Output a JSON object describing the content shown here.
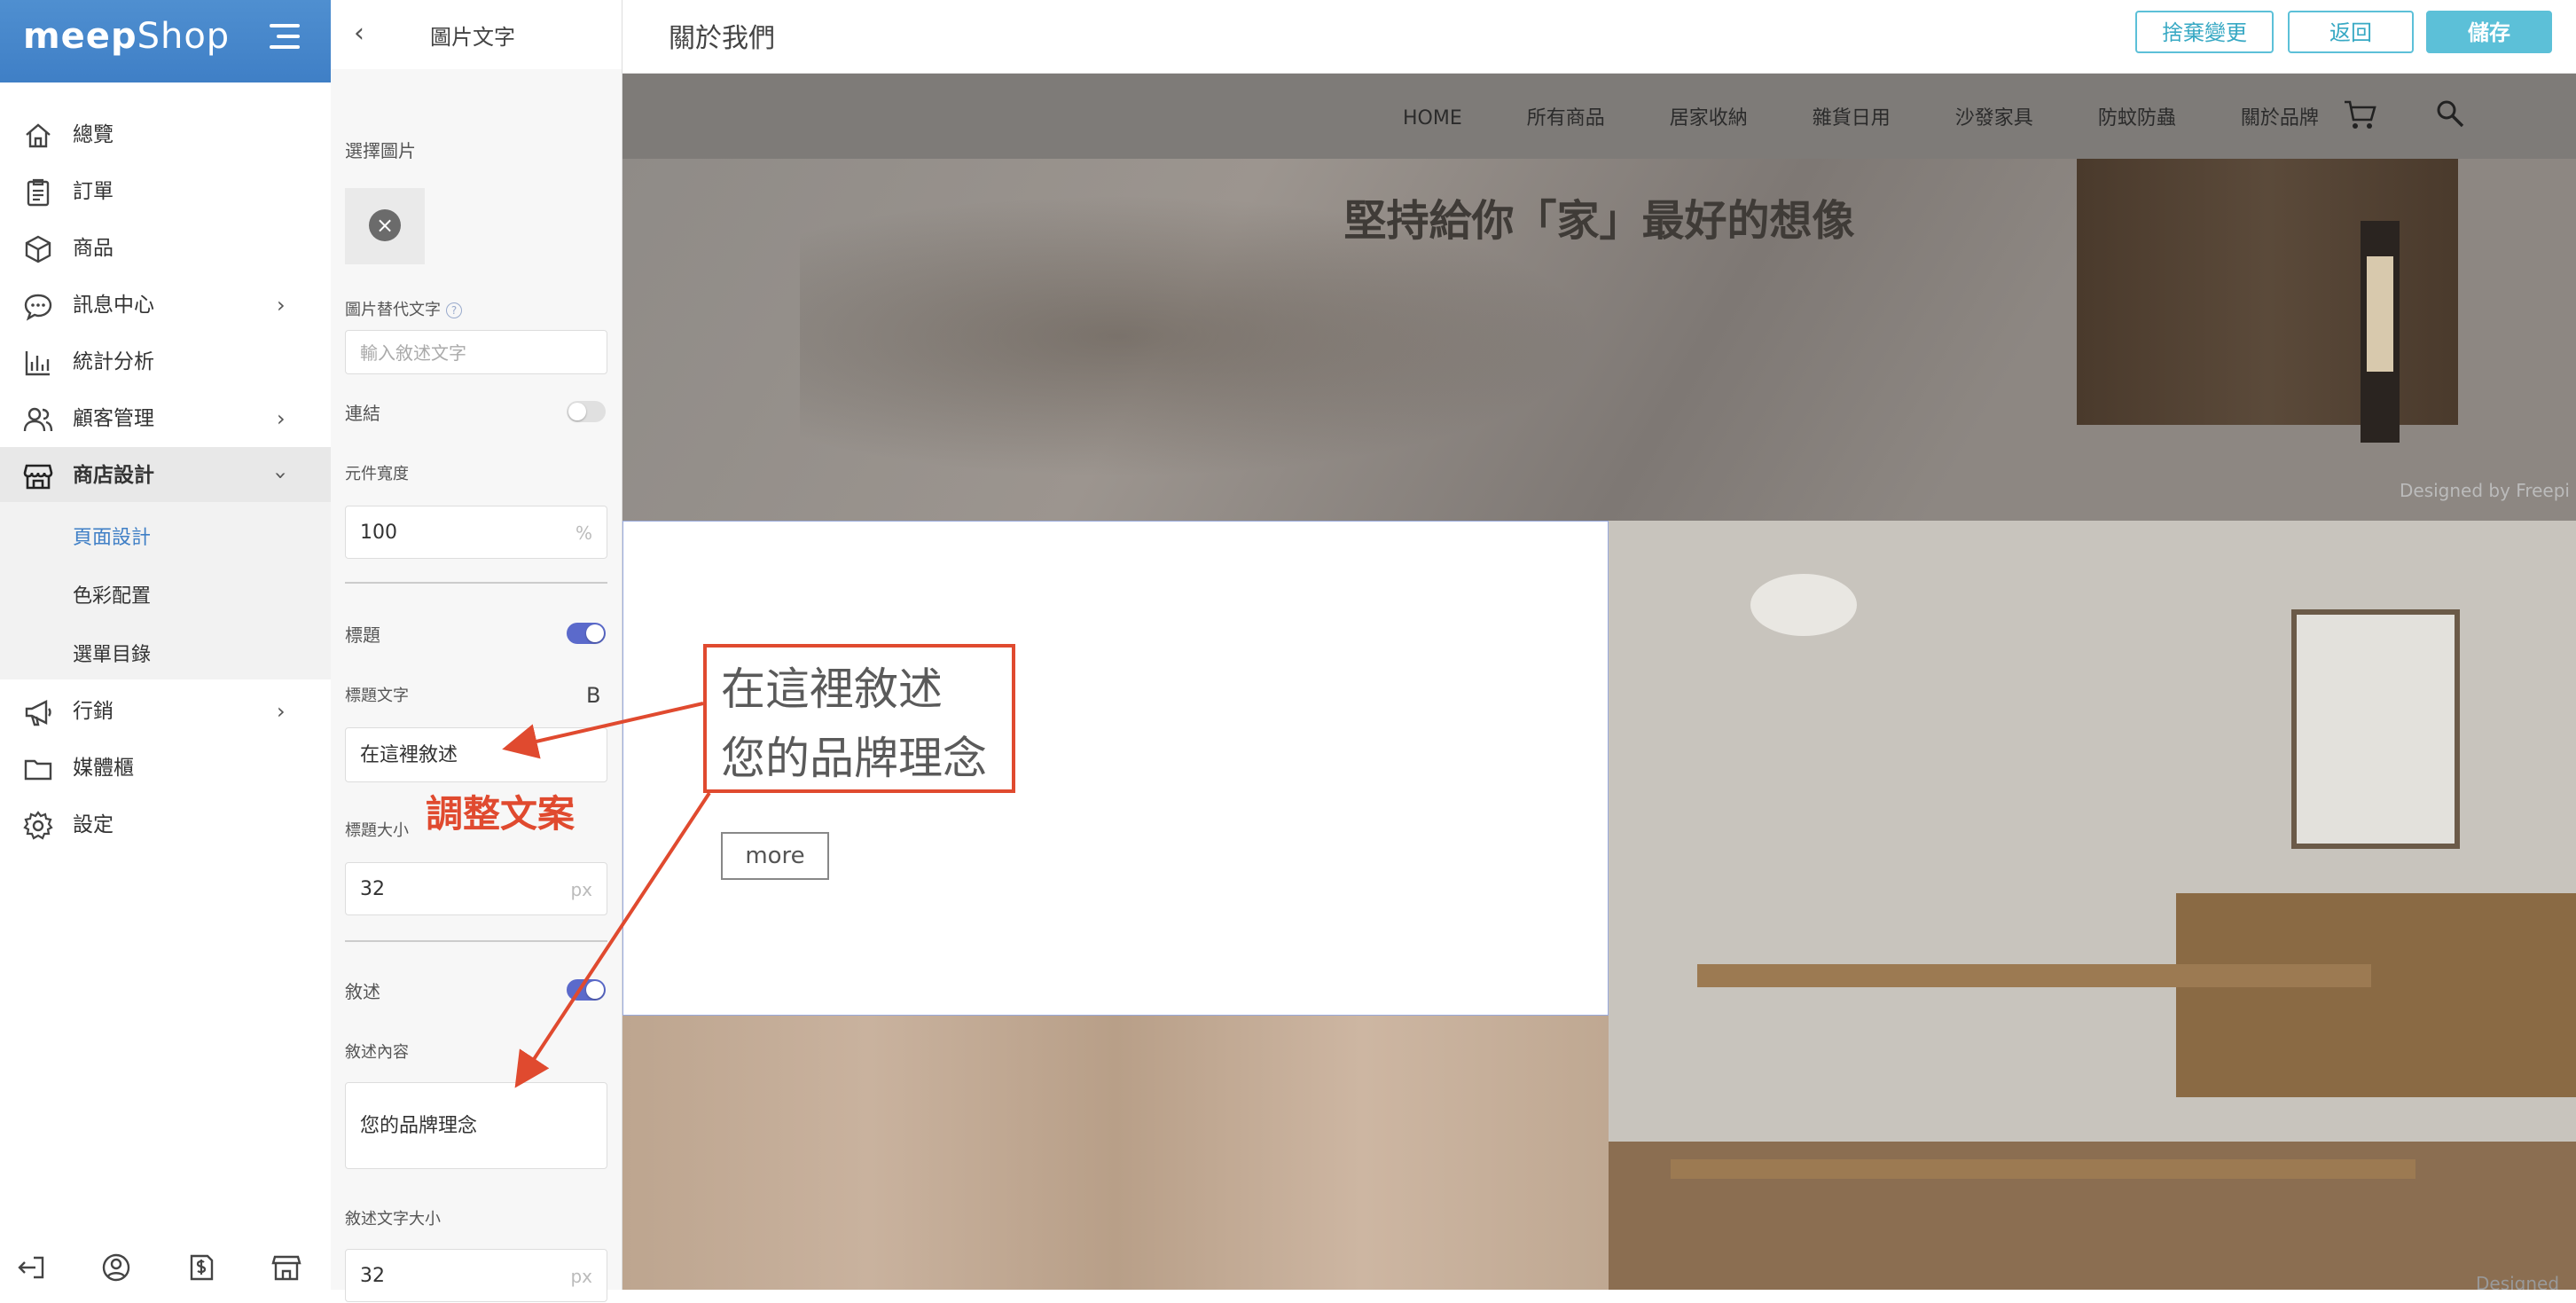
{
  "brand": {
    "name_bold": "meep",
    "name_light": "Shop"
  },
  "sidebar": {
    "items": [
      {
        "label": "總覽",
        "icon": "home-icon",
        "has_arrow": false
      },
      {
        "label": "訂單",
        "icon": "order-icon",
        "has_arrow": false
      },
      {
        "label": "商品",
        "icon": "product-box-icon",
        "has_arrow": false
      },
      {
        "label": "訊息中心",
        "icon": "chat-icon",
        "has_arrow": true
      },
      {
        "label": "統計分析",
        "icon": "bar-chart-icon",
        "has_arrow": false
      },
      {
        "label": "顧客管理",
        "icon": "users-icon",
        "has_arrow": true
      },
      {
        "label": "商店設計",
        "icon": "store-icon",
        "has_arrow": true,
        "expanded": true
      },
      {
        "label": "行銷",
        "icon": "megaphone-icon",
        "has_arrow": true
      },
      {
        "label": "媒體櫃",
        "icon": "folder-icon",
        "has_arrow": false
      },
      {
        "label": "設定",
        "icon": "gear-icon",
        "has_arrow": false
      }
    ],
    "sub_items": [
      {
        "label": "頁面設計",
        "current": true
      },
      {
        "label": "色彩配置",
        "current": false
      },
      {
        "label": "選單目錄",
        "current": false
      }
    ],
    "bottom_icons": [
      "logout-icon",
      "account-icon",
      "billing-icon",
      "storefront-icon"
    ]
  },
  "panel": {
    "title": "圖片文字",
    "select_image_label": "選擇圖片",
    "alt_text_label": "圖片替代文字",
    "alt_text_placeholder": "輸入敘述文字",
    "link_label": "連結",
    "link_enabled": false,
    "width_label": "元件寬度",
    "width_value": "100",
    "width_unit": "%",
    "heading_label": "標題",
    "heading_enabled": true,
    "heading_text_label": "標題文字",
    "bold_label": "B",
    "heading_text_value": "在這裡敘述",
    "heading_size_label": "標題大小",
    "heading_size_value": "32",
    "heading_size_unit": "px",
    "desc_label": "敘述",
    "desc_enabled": true,
    "desc_content_label": "敘述內容",
    "desc_content_value": "您的品牌理念",
    "desc_size_label": "敘述文字大小",
    "desc_size_value": "32",
    "desc_size_unit": "px"
  },
  "topbar": {
    "page_name": "關於我們",
    "discard_label": "捨棄變更",
    "back_label": "返回",
    "save_label": "儲存",
    "accent_color": "#5cc0d8"
  },
  "preview": {
    "nav_links": [
      "HOME",
      "所有商品",
      "居家收納",
      "雜貨日用",
      "沙發家具",
      "防蚊防蟲",
      "關於品牌"
    ],
    "hero_title": "堅持給你「家」最好的想像",
    "credit_text": "Designed by Freepi",
    "credit_text_2": "Designed by Freep",
    "brand_title_line1": "在這裡敘述",
    "brand_title_line2": "您的品牌理念",
    "more_label": "more"
  },
  "annotation": {
    "label": "調整文案",
    "color": "#e04a2f"
  }
}
